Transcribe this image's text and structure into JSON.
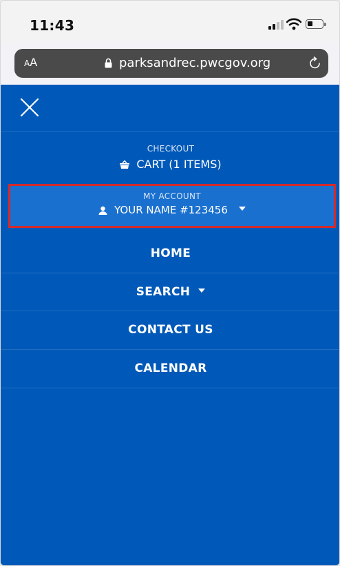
{
  "status_bar": {
    "time": "11:43"
  },
  "browser": {
    "aa_label_small": "A",
    "aa_label_large": "A",
    "url": "parksandrec.pwcgov.org"
  },
  "header": {
    "checkout_label": "CHECKOUT",
    "cart_label": "CART (1 ITEMS)",
    "account_label": "MY ACCOUNT",
    "account_name": "YOUR NAME #123456"
  },
  "menu": {
    "home": "HOME",
    "search": "SEARCH",
    "contact": "CONTACT US",
    "calendar": "CALENDAR"
  },
  "colors": {
    "page_bg": "#0059b8",
    "account_bg": "#1a70cf",
    "highlight_border": "#d42a2a"
  },
  "icons": [
    "signal-icon",
    "wifi-icon",
    "battery-icon",
    "lock-icon",
    "reload-icon",
    "close-icon",
    "cart-icon",
    "user-icon",
    "chevron-down-icon"
  ]
}
